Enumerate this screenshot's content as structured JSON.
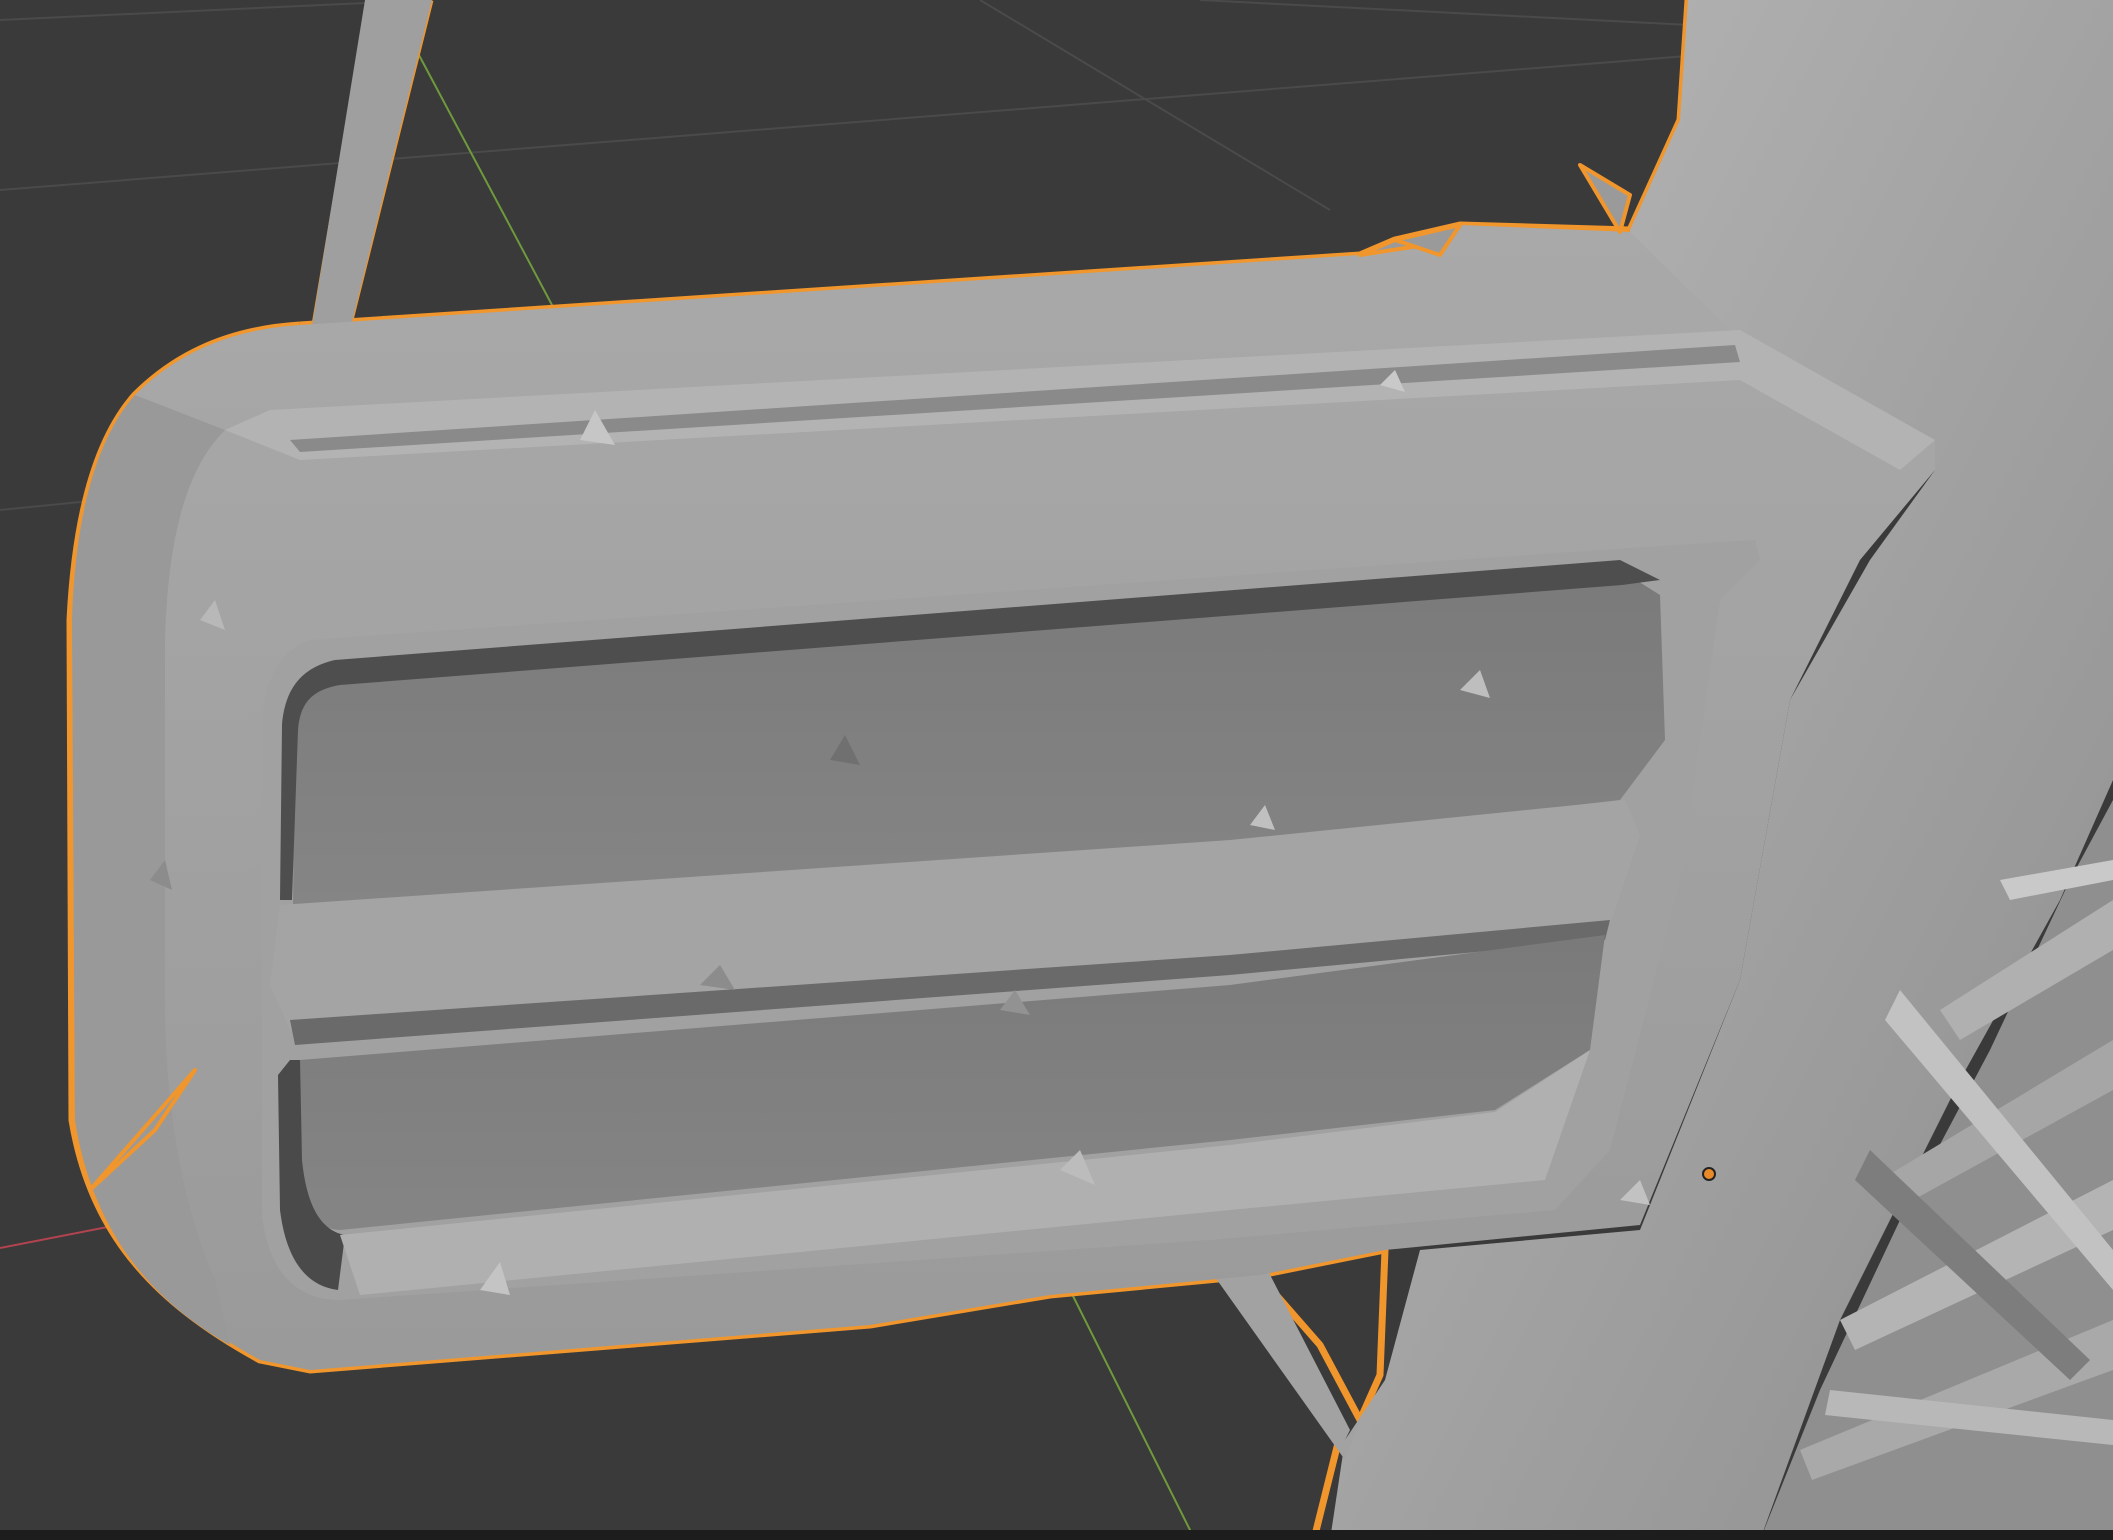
{
  "viewport": {
    "view_mode": "solid",
    "colors": {
      "background": "#3a3a3a",
      "grid_line": "#4a4a4a",
      "x_axis": "#b2434f",
      "y_axis": "#6f9a3c",
      "selection_outline": "#f0962c",
      "mesh_light": "#a8a8a8",
      "mesh_mid": "#959595",
      "mesh_dark": "#7c7c7c",
      "mesh_shadow": "#4e4e4e",
      "origin_point": "#e8892a"
    }
  },
  "scene": {
    "selected_object": "grille-mesh",
    "origin_marker": "object-origin"
  }
}
